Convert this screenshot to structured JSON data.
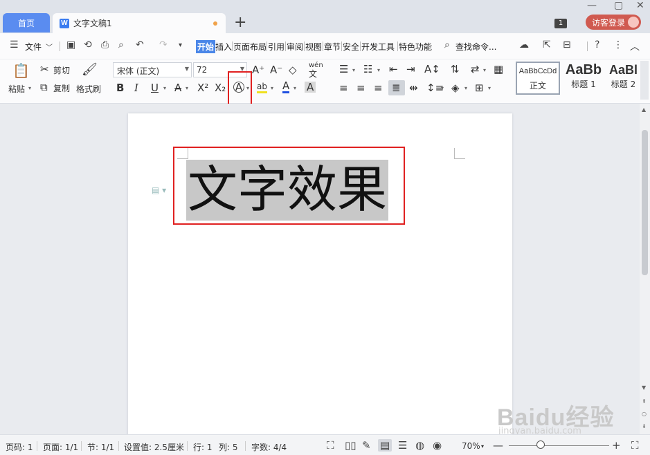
{
  "tabs": {
    "home": "首页",
    "document": "文字文稿1",
    "doc_icon": "W"
  },
  "title_right": {
    "notify_count": "1",
    "login": "访客登录"
  },
  "menu": {
    "file": "文件",
    "items": [
      "开始",
      "插入",
      "页面布局",
      "引用",
      "审阅",
      "视图",
      "章节",
      "安全",
      "开发工具",
      "特色功能"
    ],
    "search": "查找命令..."
  },
  "ribbon": {
    "paste": "粘贴",
    "cut": "剪切",
    "copy": "复制",
    "format_painter": "格式刷",
    "font_family": "宋体 (正文)",
    "font_size": "72",
    "phonetic": "wén",
    "highlight_glyph": "ab",
    "styles": [
      {
        "sample": "AaBbCcDd",
        "name": "正文"
      },
      {
        "sample": "AaBb",
        "name": "标题 1"
      },
      {
        "sample": "AaBl",
        "name": "标题 2"
      }
    ]
  },
  "document": {
    "text": "文字效果"
  },
  "status": {
    "page_num": "页码: 1",
    "pages": "页面: 1/1",
    "section": "节: 1/1",
    "setting": "设置值: 2.5厘米",
    "row": "行: 1",
    "col": "列: 5",
    "word_count": "字数: 4/4",
    "zoom": "70%"
  },
  "watermark": {
    "logo": "Baidu经验",
    "url": "jingyan.baidu.com"
  }
}
